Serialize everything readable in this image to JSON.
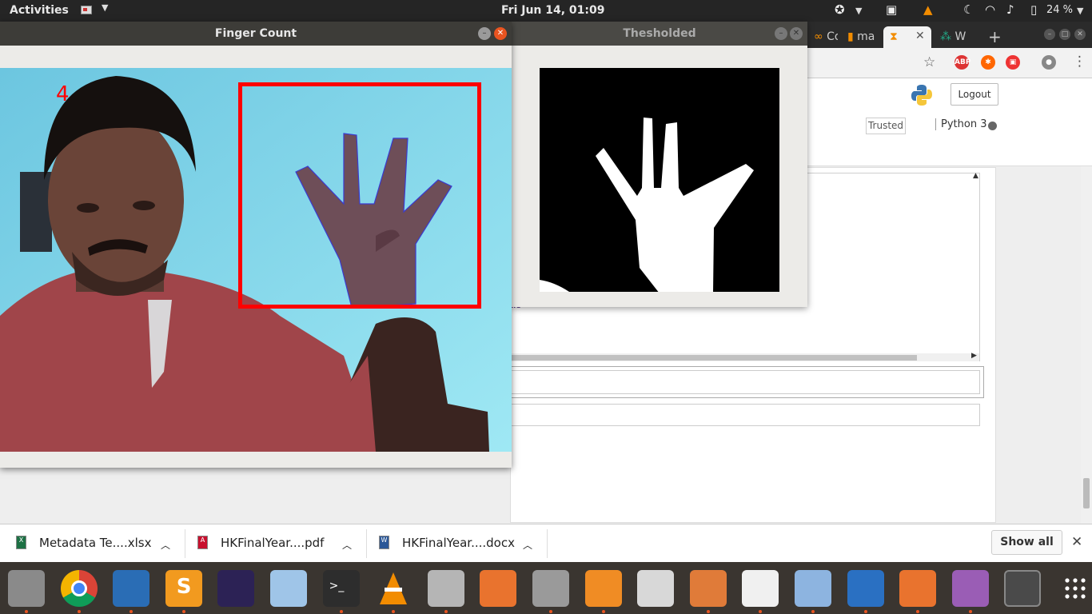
{
  "topbar": {
    "activities": "Activities",
    "clock": "Fri Jun 14, 01:09",
    "battery": "24 %"
  },
  "browser": {
    "tabs": [
      {
        "label": "Co",
        "active": false
      },
      {
        "label": "ma",
        "active": false
      },
      {
        "label": "",
        "active": true
      },
      {
        "label": "W",
        "active": false
      }
    ],
    "new_tab": "+",
    "logout_label": "Logout",
    "trusted_label": "Trusted",
    "kernel_label": "Python 3",
    "output_fragment": "ws"
  },
  "downloads": {
    "items": [
      {
        "name": "Metadata Te....xlsx",
        "icon": "excel-icon",
        "color": "#1d7044"
      },
      {
        "name": "HKFinalYear....pdf",
        "icon": "pdf-icon",
        "color": "#c8102e"
      },
      {
        "name": "HKFinalYear....docx",
        "icon": "word-icon",
        "color": "#2b5797"
      }
    ],
    "show_all": "Show all",
    "close": "✕"
  },
  "finger_window": {
    "title": "Finger Count",
    "count": "4",
    "roi_color": "#ff0000"
  },
  "threshold_window": {
    "title": "Thesholded"
  },
  "dock": {
    "apps": [
      {
        "name": "files-icon",
        "color": "#8a8a8a"
      },
      {
        "name": "chrome-icon",
        "color": "#e8e8e8"
      },
      {
        "name": "vscode-icon",
        "color": "#2a6db5"
      },
      {
        "name": "sublime-icon",
        "color": "#f29a1f"
      },
      {
        "name": "eclipse-icon",
        "color": "#2c2255"
      },
      {
        "name": "virtualbox-icon",
        "color": "#9fc5e8"
      },
      {
        "name": "terminal-icon",
        "color": "#2d2d2d"
      },
      {
        "name": "vlc-icon",
        "color": "#f28c00"
      },
      {
        "name": "installer-icon",
        "color": "#b5b5b5"
      },
      {
        "name": "software-center-icon",
        "color": "#e9732e"
      },
      {
        "name": "settings-icon",
        "color": "#9a9a9a"
      },
      {
        "name": "calculator-icon",
        "color": "#f08c24"
      },
      {
        "name": "spider-icon",
        "color": "#d8d8d8"
      },
      {
        "name": "presentation-icon",
        "color": "#e07b39"
      },
      {
        "name": "pdf-viewer-icon",
        "color": "#f0f0f0"
      },
      {
        "name": "image-viewer-icon",
        "color": "#8db4e0"
      },
      {
        "name": "writer-icon",
        "color": "#2a70c2"
      },
      {
        "name": "inkscape-icon",
        "color": "#e9732e"
      },
      {
        "name": "video-icon",
        "color": "#9a5db5"
      },
      {
        "name": "blocked-icon",
        "color": "#4a4a4a"
      },
      {
        "name": "app-grid-icon",
        "color": "#3a3530"
      }
    ]
  }
}
